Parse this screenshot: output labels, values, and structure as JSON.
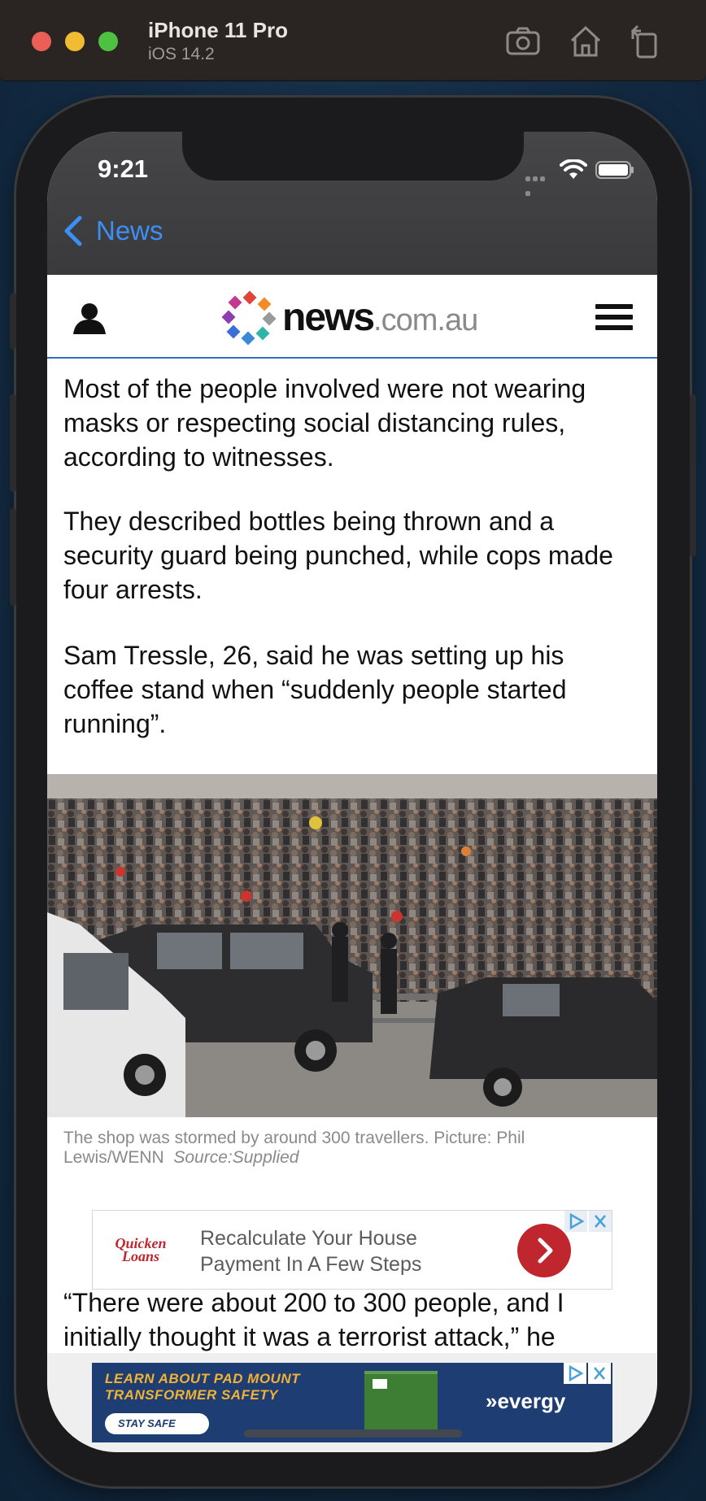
{
  "simulator": {
    "device": "iPhone 11 Pro",
    "os": "iOS 14.2",
    "icons": [
      "screenshot-icon",
      "home-icon",
      "rotate-icon"
    ]
  },
  "status_bar": {
    "time": "9:21"
  },
  "nav": {
    "back_label": "News"
  },
  "site": {
    "logo_name": "news",
    "logo_domain": ".com.au",
    "icons": [
      "user-icon",
      "hamburger-menu-icon"
    ]
  },
  "article": {
    "paragraphs": [
      "Most of the people involved were not wearing masks or respecting social distancing rules, according to witnesses.",
      "They described bottles being thrown and a security guard being punched, while cops made four arrests.",
      "Sam Tressle, 26, said he was setting up his coffee stand when “suddenly people started running”."
    ],
    "caption": "The shop was stormed by around 300 travellers. Picture: Phil Lewis/WENN",
    "caption_source": "Source:Supplied",
    "quote": "“There were about 200 to 300 people, and I initially thought it was a terrorist attack,” he"
  },
  "ads": {
    "inline": {
      "brand_line1": "Quicken",
      "brand_line2": "Loans",
      "text": "Recalculate Your House Payment In A Few Steps",
      "brand_color": "#c0262d"
    },
    "banner": {
      "headline_line1": "LEARN ABOUT PAD MOUNT",
      "headline_line2": "TRANSFORMER SAFETY",
      "cta": "STAY SAFE",
      "brand": "»evergy",
      "bg_color": "#1e3d73"
    }
  },
  "colors": {
    "accent": "#3b8ff5",
    "header_border": "#2f6ec1"
  }
}
